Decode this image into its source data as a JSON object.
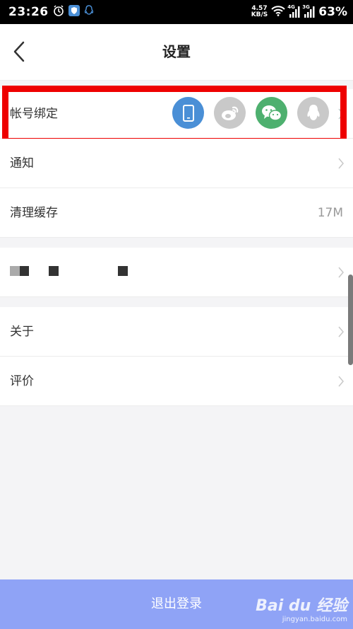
{
  "status_bar": {
    "time": "23:26",
    "net_speed_value": "4.57",
    "net_speed_unit": "KB/S",
    "signal_1": "4G",
    "signal_2": "3G",
    "battery": "63%"
  },
  "header": {
    "title": "设置",
    "back_icon": "chevron-left-icon"
  },
  "settings": {
    "account_binding": {
      "label": "帐号绑定",
      "providers": [
        {
          "name": "phone",
          "icon": "phone-icon",
          "color": "#4a8fd6"
        },
        {
          "name": "weibo",
          "icon": "weibo-icon",
          "color": "#c9c9c9"
        },
        {
          "name": "wechat",
          "icon": "wechat-icon",
          "color": "#4eb06f"
        },
        {
          "name": "qq",
          "icon": "qq-icon",
          "color": "#c9c9c9"
        }
      ]
    },
    "notification": {
      "label": "通知"
    },
    "clear_cache": {
      "label": "清理缓存",
      "value": "17M"
    },
    "about": {
      "label": "关于"
    },
    "rate": {
      "label": "评价"
    }
  },
  "logout": {
    "label": "退出登录"
  },
  "watermark": {
    "brand": "Bai du 经验",
    "url": "jingyan.baidu.com"
  },
  "colors": {
    "accent": "#8fa3f6",
    "highlight": "#ee0000"
  }
}
